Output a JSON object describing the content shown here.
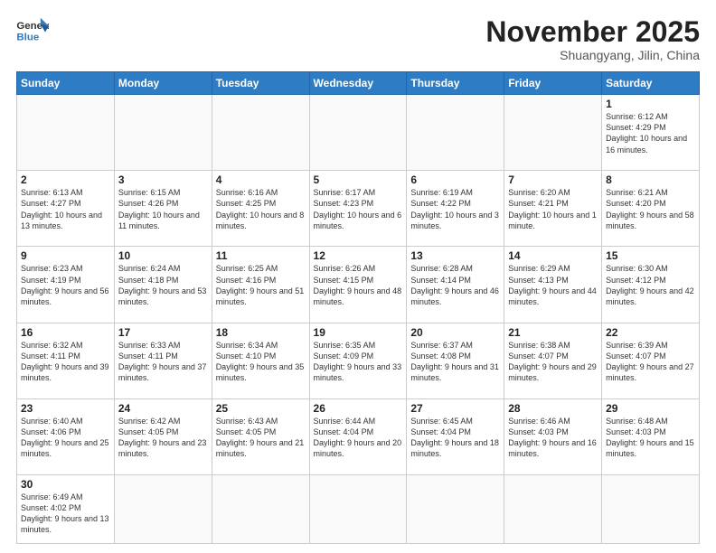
{
  "header": {
    "logo_general": "General",
    "logo_blue": "Blue",
    "month": "November 2025",
    "location": "Shuangyang, Jilin, China"
  },
  "weekdays": [
    "Sunday",
    "Monday",
    "Tuesday",
    "Wednesday",
    "Thursday",
    "Friday",
    "Saturday"
  ],
  "weeks": [
    [
      {
        "day": "",
        "info": ""
      },
      {
        "day": "",
        "info": ""
      },
      {
        "day": "",
        "info": ""
      },
      {
        "day": "",
        "info": ""
      },
      {
        "day": "",
        "info": ""
      },
      {
        "day": "",
        "info": ""
      },
      {
        "day": "1",
        "info": "Sunrise: 6:12 AM\nSunset: 4:29 PM\nDaylight: 10 hours and 16 minutes."
      }
    ],
    [
      {
        "day": "2",
        "info": "Sunrise: 6:13 AM\nSunset: 4:27 PM\nDaylight: 10 hours and 13 minutes."
      },
      {
        "day": "3",
        "info": "Sunrise: 6:15 AM\nSunset: 4:26 PM\nDaylight: 10 hours and 11 minutes."
      },
      {
        "day": "4",
        "info": "Sunrise: 6:16 AM\nSunset: 4:25 PM\nDaylight: 10 hours and 8 minutes."
      },
      {
        "day": "5",
        "info": "Sunrise: 6:17 AM\nSunset: 4:23 PM\nDaylight: 10 hours and 6 minutes."
      },
      {
        "day": "6",
        "info": "Sunrise: 6:19 AM\nSunset: 4:22 PM\nDaylight: 10 hours and 3 minutes."
      },
      {
        "day": "7",
        "info": "Sunrise: 6:20 AM\nSunset: 4:21 PM\nDaylight: 10 hours and 1 minute."
      },
      {
        "day": "8",
        "info": "Sunrise: 6:21 AM\nSunset: 4:20 PM\nDaylight: 9 hours and 58 minutes."
      }
    ],
    [
      {
        "day": "9",
        "info": "Sunrise: 6:23 AM\nSunset: 4:19 PM\nDaylight: 9 hours and 56 minutes."
      },
      {
        "day": "10",
        "info": "Sunrise: 6:24 AM\nSunset: 4:18 PM\nDaylight: 9 hours and 53 minutes."
      },
      {
        "day": "11",
        "info": "Sunrise: 6:25 AM\nSunset: 4:16 PM\nDaylight: 9 hours and 51 minutes."
      },
      {
        "day": "12",
        "info": "Sunrise: 6:26 AM\nSunset: 4:15 PM\nDaylight: 9 hours and 48 minutes."
      },
      {
        "day": "13",
        "info": "Sunrise: 6:28 AM\nSunset: 4:14 PM\nDaylight: 9 hours and 46 minutes."
      },
      {
        "day": "14",
        "info": "Sunrise: 6:29 AM\nSunset: 4:13 PM\nDaylight: 9 hours and 44 minutes."
      },
      {
        "day": "15",
        "info": "Sunrise: 6:30 AM\nSunset: 4:12 PM\nDaylight: 9 hours and 42 minutes."
      }
    ],
    [
      {
        "day": "16",
        "info": "Sunrise: 6:32 AM\nSunset: 4:11 PM\nDaylight: 9 hours and 39 minutes."
      },
      {
        "day": "17",
        "info": "Sunrise: 6:33 AM\nSunset: 4:11 PM\nDaylight: 9 hours and 37 minutes."
      },
      {
        "day": "18",
        "info": "Sunrise: 6:34 AM\nSunset: 4:10 PM\nDaylight: 9 hours and 35 minutes."
      },
      {
        "day": "19",
        "info": "Sunrise: 6:35 AM\nSunset: 4:09 PM\nDaylight: 9 hours and 33 minutes."
      },
      {
        "day": "20",
        "info": "Sunrise: 6:37 AM\nSunset: 4:08 PM\nDaylight: 9 hours and 31 minutes."
      },
      {
        "day": "21",
        "info": "Sunrise: 6:38 AM\nSunset: 4:07 PM\nDaylight: 9 hours and 29 minutes."
      },
      {
        "day": "22",
        "info": "Sunrise: 6:39 AM\nSunset: 4:07 PM\nDaylight: 9 hours and 27 minutes."
      }
    ],
    [
      {
        "day": "23",
        "info": "Sunrise: 6:40 AM\nSunset: 4:06 PM\nDaylight: 9 hours and 25 minutes."
      },
      {
        "day": "24",
        "info": "Sunrise: 6:42 AM\nSunset: 4:05 PM\nDaylight: 9 hours and 23 minutes."
      },
      {
        "day": "25",
        "info": "Sunrise: 6:43 AM\nSunset: 4:05 PM\nDaylight: 9 hours and 21 minutes."
      },
      {
        "day": "26",
        "info": "Sunrise: 6:44 AM\nSunset: 4:04 PM\nDaylight: 9 hours and 20 minutes."
      },
      {
        "day": "27",
        "info": "Sunrise: 6:45 AM\nSunset: 4:04 PM\nDaylight: 9 hours and 18 minutes."
      },
      {
        "day": "28",
        "info": "Sunrise: 6:46 AM\nSunset: 4:03 PM\nDaylight: 9 hours and 16 minutes."
      },
      {
        "day": "29",
        "info": "Sunrise: 6:48 AM\nSunset: 4:03 PM\nDaylight: 9 hours and 15 minutes."
      }
    ],
    [
      {
        "day": "30",
        "info": "Sunrise: 6:49 AM\nSunset: 4:02 PM\nDaylight: 9 hours and 13 minutes."
      },
      {
        "day": "",
        "info": ""
      },
      {
        "day": "",
        "info": ""
      },
      {
        "day": "",
        "info": ""
      },
      {
        "day": "",
        "info": ""
      },
      {
        "day": "",
        "info": ""
      },
      {
        "day": "",
        "info": ""
      }
    ]
  ]
}
